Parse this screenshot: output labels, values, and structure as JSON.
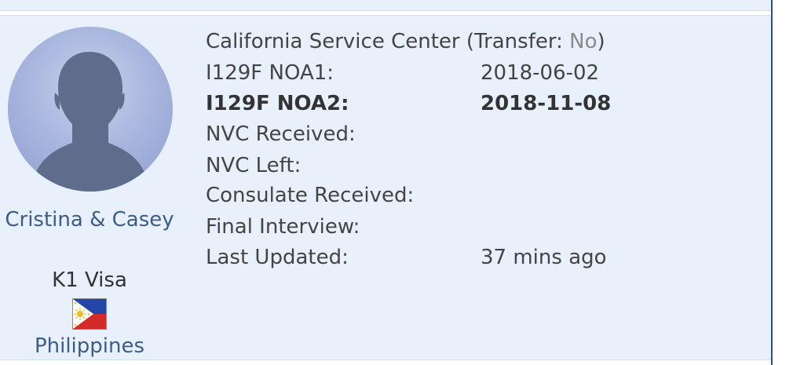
{
  "member": {
    "name": "Cristina & Casey",
    "visa_type": "K1 Visa",
    "country": "Philippines",
    "avatar_icon": "user-silhouette-icon",
    "flag_icon": "philippines-flag-icon"
  },
  "case": {
    "service_center": "California Service Center",
    "transfer_prefix": "(Transfer: ",
    "transfer_value": "No",
    "transfer_suffix": ")",
    "rows": [
      {
        "label": "I129F NOA1:",
        "value": "2018-06-02",
        "bold": false
      },
      {
        "label": "I129F NOA2:",
        "value": "2018-11-08",
        "bold": true
      },
      {
        "label": "NVC Received:",
        "value": "",
        "bold": false
      },
      {
        "label": "NVC Left:",
        "value": "",
        "bold": false
      },
      {
        "label": "Consulate Received:",
        "value": "",
        "bold": false
      },
      {
        "label": "Final Interview:",
        "value": "",
        "bold": false
      },
      {
        "label": "Last Updated:",
        "value": "37 mins ago",
        "bold": false
      }
    ]
  },
  "colors": {
    "card_background": "#e7f0fb",
    "link": "#3d5c88",
    "accent_border": "#2f4f86"
  }
}
